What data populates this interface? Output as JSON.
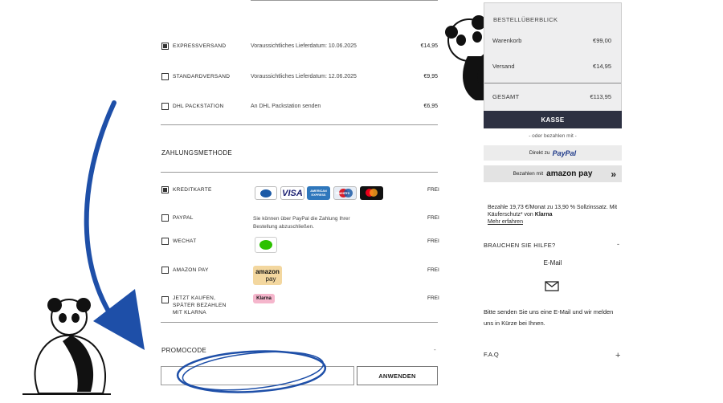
{
  "shipping": [
    {
      "label": "EXPRESSVERSAND",
      "info": "Voraussichtliches Lieferdatum: 10.06.2025",
      "price": "€14,95",
      "checked": true
    },
    {
      "label": "STANDARDVERSAND",
      "info": "Voraussichtliches Lieferdatum: 12.06.2025",
      "price": "€9,95",
      "checked": false
    },
    {
      "label": "DHL PACKSTATION",
      "info": "An DHL Packstation senden",
      "price": "€6,95",
      "checked": false
    }
  ],
  "payment": {
    "title": "ZAHLUNGSMETHODE",
    "methods": [
      {
        "label": "KREDITKARTE",
        "fee": "FREI",
        "checked": true
      },
      {
        "label": "PAYPAL",
        "fee": "FREI",
        "desc": "Sie können über PayPal die Zahlung Ihrer Bestellung abzuschließen.",
        "checked": false
      },
      {
        "label": "WECHAT",
        "fee": "FREI",
        "checked": false
      },
      {
        "label": "AMAZON PAY",
        "fee": "FREI",
        "checked": false
      },
      {
        "label": "JETZT KAUFEN, SPÄTER BEZAHLEN MIT KLARNA",
        "fee": "FREI",
        "checked": false
      }
    ],
    "cards": {
      "visa": "VISA",
      "amex": "AMERICAN EXPRESS",
      "maestro": "Maestro",
      "amazon1": "amazon",
      "amazon2": "pay",
      "klarna": "Klarna"
    }
  },
  "promo": {
    "title": "PROMOCODE",
    "collapse": "-",
    "input_value": "",
    "apply": "ANWENDEN"
  },
  "summary": {
    "title": "BESTELLÜBERBLICK",
    "rows": [
      {
        "label": "Warenkorb",
        "value": "€99,00"
      },
      {
        "label": "Versand",
        "value": "€14,95"
      }
    ],
    "total_label": "GESAMT",
    "total_value": "€113,95",
    "checkout": "KASSE",
    "or_pay": "- oder bezahlen mit -",
    "paypal_prefix": "Direkt zu",
    "paypal_brand": "PayPal",
    "amazon_prefix": "Bezahlen mit",
    "amazon_brand": "amazon pay",
    "amazon_chevron": "»",
    "klarna_text": "Bezahle 19,73 €/Monat zu 13,90 % Sollzinssatz. Mit Käuferschutz* von",
    "klarna_brand": "Klarna",
    "klarna_link": "Mehr erfahren"
  },
  "help": {
    "title": "BRAUCHEN SIE HILFE?",
    "toggle": "-",
    "email_label": "E-Mail",
    "text": "Bitte senden Sie uns eine E-Mail und wir melden uns in Kürze bei Ihnen.",
    "faq": "F.A.Q",
    "faq_toggle": "+"
  },
  "colors": {
    "accent": "#2d3142",
    "arrow": "#1e4fa8",
    "paypal": "#1f3a8a",
    "klarna": "#f5b6cc"
  }
}
